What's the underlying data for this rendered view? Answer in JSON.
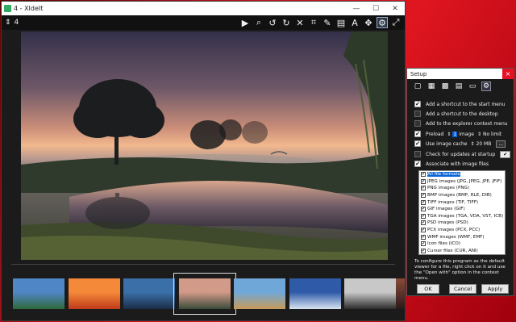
{
  "window": {
    "title": "4 - XIdeIt",
    "controls": [
      "—",
      "☐",
      "✕"
    ]
  },
  "toolbar": {
    "page": "4",
    "tools": [
      {
        "name": "play-icon",
        "glyph": "▶"
      },
      {
        "name": "zoom-icon",
        "glyph": "⌕"
      },
      {
        "name": "rotate-left-icon",
        "glyph": "↺"
      },
      {
        "name": "rotate-right-icon",
        "glyph": "↻"
      },
      {
        "name": "delete-icon",
        "glyph": "✕"
      },
      {
        "name": "crop-icon",
        "glyph": "⌗"
      },
      {
        "name": "paint-icon",
        "glyph": "✎"
      },
      {
        "name": "info-icon",
        "glyph": "▤"
      },
      {
        "name": "text-icon",
        "glyph": "A"
      },
      {
        "name": "adjust-icon",
        "glyph": "✥"
      },
      {
        "name": "settings-icon",
        "glyph": "⚙",
        "selected": true
      },
      {
        "name": "fullscreen-icon",
        "glyph": "⤢"
      }
    ]
  },
  "filmstrip": {
    "thumbs": [
      {
        "name": "thumb-lighthouse",
        "c1": "#4f86c6",
        "c2": "#2f6a3a"
      },
      {
        "name": "thumb-autumn",
        "c1": "#f4893a",
        "c2": "#c03a1a"
      },
      {
        "name": "thumb-lake",
        "c1": "#3b6fa8",
        "c2": "#1b2d48"
      },
      {
        "name": "thumb-sunrise",
        "c1": "#d29a88",
        "c2": "#3a4a3a",
        "selected": true
      },
      {
        "name": "thumb-city",
        "c1": "#6fa8d8",
        "c2": "#c89a58"
      },
      {
        "name": "thumb-coast",
        "c1": "#2f5aa8",
        "c2": "#d8e4f0"
      },
      {
        "name": "thumb-forest",
        "c1": "#c8c8c8",
        "c2": "#2a2a2a"
      }
    ]
  },
  "setup": {
    "title": "Setup",
    "close": "×",
    "tabs": [
      "▢",
      "▦",
      "▩",
      "▤",
      "▭",
      "⚙"
    ],
    "options": {
      "start_menu": "Add a shortcut to the start menu",
      "desktop": "Add a shortcut to the desktop",
      "context": "Add to the explorer context menu",
      "preload": "Preload",
      "preload_n": "1",
      "preload_unit": "image",
      "no_limit": "No limit",
      "cache": "Use image cache",
      "cache_size": "20 MB",
      "cache_btn": "...",
      "updates": "Check for updates at startup",
      "updates_btn": "✔",
      "associate": "Associate with image files"
    },
    "assoc": [
      {
        "label": "All file formats",
        "selected": true
      },
      {
        "label": "JPEG images (JPG, JPEG, JPE, JFIF)"
      },
      {
        "label": "PNG images (PNG)"
      },
      {
        "label": "BMP images (BMP, RLE, DIB)"
      },
      {
        "label": "TIFF images (TIF, TIFF)"
      },
      {
        "label": "GIF images (GIF)"
      },
      {
        "label": "TGA images (TGA, VDA, VST, ICB)"
      },
      {
        "label": "PSD images (PSD)"
      },
      {
        "label": "PCX images (PCX, PCC)"
      },
      {
        "label": "WMF images (WMF, EMF)"
      },
      {
        "label": "Icon files (ICO)"
      },
      {
        "label": "Cursor files (CUR, ANI)"
      }
    ],
    "note": "To configure this program as the default viewer for a file, right click on it and use the \"Open with\" option in the context menu.",
    "buttons": {
      "ok": "OK",
      "cancel": "Cancel",
      "apply": "Apply"
    }
  }
}
